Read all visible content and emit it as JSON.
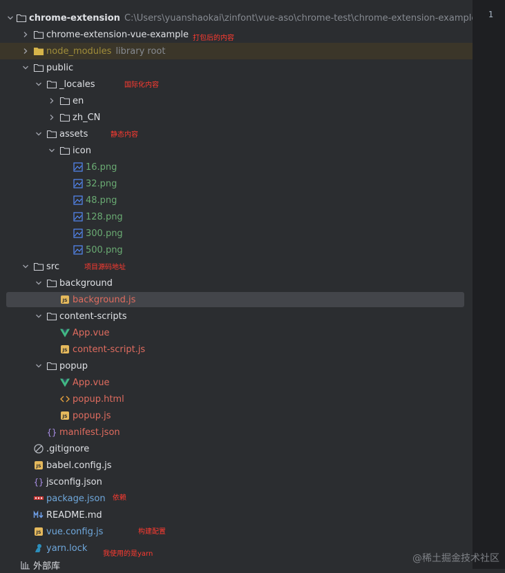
{
  "editor": {
    "line_number": "1"
  },
  "tree": {
    "root": {
      "name": "chrome-extension",
      "path": "C:\\Users\\yuanshaokai\\zinfont\\vue-aso\\chrome-test\\chrome-extension-example\\c"
    },
    "items": [
      {
        "name": "chrome-extension-vue-example"
      },
      {
        "name": "node_modules",
        "hint": "library root"
      },
      {
        "name": "public"
      },
      {
        "name": "_locales"
      },
      {
        "name": "en"
      },
      {
        "name": "zh_CN"
      },
      {
        "name": "assets"
      },
      {
        "name": "icon"
      },
      {
        "name": "16.png"
      },
      {
        "name": "32.png"
      },
      {
        "name": "48.png"
      },
      {
        "name": "128.png"
      },
      {
        "name": "300.png"
      },
      {
        "name": "500.png"
      },
      {
        "name": "src"
      },
      {
        "name": "background"
      },
      {
        "name": "background.js"
      },
      {
        "name": "content-scripts"
      },
      {
        "name": "App.vue"
      },
      {
        "name": "content-script.js"
      },
      {
        "name": "popup"
      },
      {
        "name": "App.vue"
      },
      {
        "name": "popup.html"
      },
      {
        "name": "popup.js"
      },
      {
        "name": "manifest.json"
      },
      {
        "name": ".gitignore"
      },
      {
        "name": "babel.config.js"
      },
      {
        "name": "jsconfig.json"
      },
      {
        "name": "package.json"
      },
      {
        "name": "README.md"
      },
      {
        "name": "vue.config.js"
      },
      {
        "name": "yarn.lock"
      },
      {
        "name": "外部库"
      }
    ]
  },
  "annotations": {
    "packaged": "打包后的内容",
    "i18n": "国际化内容",
    "static": "静态内容",
    "source": "项目源码地址",
    "deps": "依赖",
    "build": "构建配置",
    "yarn": "我使用的是yarn"
  },
  "watermark": "@稀土掘金技术社区",
  "colors": {
    "panel_bg": "#2b2d30",
    "selection": "#43454a",
    "library_highlight": "#3b3629",
    "annotation": "#ff3b30",
    "image_file": "#6aab73",
    "modified_file": "#e06c5f",
    "added_file": "#6fa8dc"
  }
}
